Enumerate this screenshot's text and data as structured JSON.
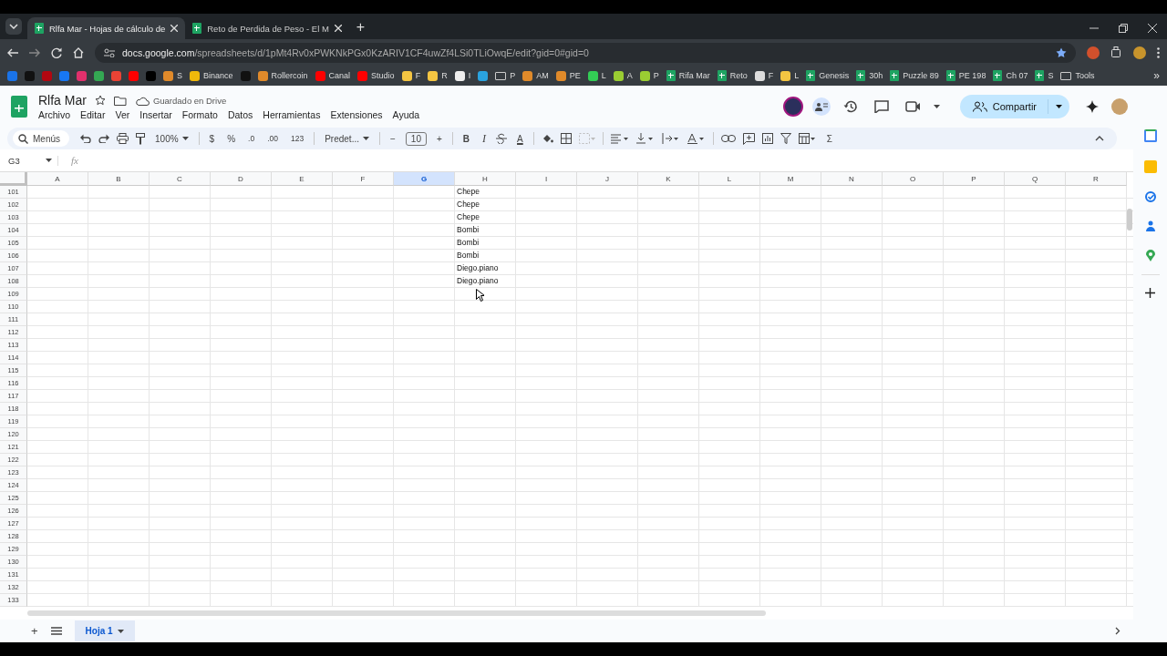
{
  "browser": {
    "tabs": [
      {
        "title": "Rlfa Mar - Hojas de cálculo de ",
        "selected": true
      },
      {
        "title": "Reto de Perdida de Peso - El M",
        "selected": false
      }
    ],
    "new_tab": "+",
    "url_host": "docs.google.com",
    "url_path": "/spreadsheets/d/1pMt4Rv0xPWKNkPGx0KzARIV1CF4uwZf4LSi0TLiOwqE/edit?gid=0#gid=0",
    "bookmarks": [
      {
        "kind": "site",
        "color": "#1a73e8"
      },
      {
        "kind": "site",
        "color": "#111111"
      },
      {
        "kind": "site",
        "color": "#b20710"
      },
      {
        "kind": "site",
        "color": "#1877f2"
      },
      {
        "kind": "site",
        "color": "#e1306c"
      },
      {
        "kind": "site",
        "color": "#34a853"
      },
      {
        "kind": "site",
        "color": "#ea4335"
      },
      {
        "kind": "site",
        "color": "#ff0000"
      },
      {
        "kind": "site",
        "color": "#000000"
      },
      {
        "kind": "site",
        "color": "#e08a2a",
        "label": "S"
      },
      {
        "kind": "site",
        "color": "#f0b90b",
        "label": "Binance"
      },
      {
        "kind": "site",
        "color": "#111111"
      },
      {
        "kind": "site",
        "color": "#e08a2a",
        "label": "Rollercoin"
      },
      {
        "kind": "site",
        "color": "#ff0000",
        "label": "Canal"
      },
      {
        "kind": "site",
        "color": "#ff0000",
        "label": "Studio"
      },
      {
        "kind": "site",
        "color": "#f4c542",
        "label": "F"
      },
      {
        "kind": "site",
        "color": "#f4c542",
        "label": "R"
      },
      {
        "kind": "site",
        "color": "#eeeeee",
        "label": "I"
      },
      {
        "kind": "site",
        "color": "#2aa3df"
      },
      {
        "kind": "folder",
        "label": "P"
      },
      {
        "kind": "site",
        "color": "#e08a2a",
        "label": "AM"
      },
      {
        "kind": "site",
        "color": "#e08a2a",
        "label": "PE"
      },
      {
        "kind": "site",
        "color": "#33cc55",
        "label": "L"
      },
      {
        "kind": "site",
        "color": "#9acd32",
        "label": "A"
      },
      {
        "kind": "site",
        "color": "#9acd32",
        "label": "P"
      },
      {
        "kind": "sheets",
        "label": "Rifa Mar"
      },
      {
        "kind": "sheets",
        "label": "Reto"
      },
      {
        "kind": "site",
        "color": "#dddddd",
        "label": "F"
      },
      {
        "kind": "site",
        "color": "#f4c542",
        "label": "L"
      },
      {
        "kind": "sheets",
        "label": "Genesis"
      },
      {
        "kind": "sheets",
        "label": "30h"
      },
      {
        "kind": "sheets",
        "label": "Puzzle 89"
      },
      {
        "kind": "sheets",
        "label": "PE 198"
      },
      {
        "kind": "sheets",
        "label": "Ch 07"
      },
      {
        "kind": "sheets",
        "label": "S"
      },
      {
        "kind": "folder",
        "label": "Tools"
      }
    ],
    "bookmarks_more": "»"
  },
  "doc": {
    "title": "Rlfa Mar",
    "save_status": "Guardado en Drive",
    "menu": [
      "Archivo",
      "Editar",
      "Ver",
      "Insertar",
      "Formato",
      "Datos",
      "Herramientas",
      "Extensiones",
      "Ayuda"
    ],
    "share": "Compartir"
  },
  "toolbar": {
    "search": "Menús",
    "zoom": "100%",
    "currency": "$",
    "percent": "%",
    "decimals_less": ".0",
    "decimals_more": ".00",
    "number_format": "123",
    "font": "Predet...",
    "size_minus": "−",
    "font_size": "10",
    "size_plus": "+",
    "bold": "B",
    "italic": "I",
    "text_color": "A",
    "functions": "Σ"
  },
  "formula_bar": {
    "cell_ref": "G3",
    "fx": "fx"
  },
  "grid": {
    "columns": [
      {
        "label": "A",
        "selected": false
      },
      {
        "label": "B",
        "selected": false
      },
      {
        "label": "C",
        "selected": false
      },
      {
        "label": "D",
        "selected": false
      },
      {
        "label": "E",
        "selected": false
      },
      {
        "label": "F",
        "selected": false
      },
      {
        "label": "G",
        "selected": true
      },
      {
        "label": "H",
        "selected": false
      },
      {
        "label": "I",
        "selected": false
      },
      {
        "label": "J",
        "selected": false
      },
      {
        "label": "K",
        "selected": false
      },
      {
        "label": "L",
        "selected": false
      },
      {
        "label": "M",
        "selected": false
      },
      {
        "label": "N",
        "selected": false
      },
      {
        "label": "O",
        "selected": false
      },
      {
        "label": "P",
        "selected": false
      },
      {
        "label": "Q",
        "selected": false
      },
      {
        "label": "R",
        "selected": false
      }
    ],
    "rows": [
      {
        "number": "101",
        "cells": {
          "H": "Chepe"
        }
      },
      {
        "number": "102",
        "cells": {
          "H": "Chepe"
        }
      },
      {
        "number": "103",
        "cells": {
          "H": "Chepe"
        }
      },
      {
        "number": "104",
        "cells": {
          "H": "Bombi"
        }
      },
      {
        "number": "105",
        "cells": {
          "H": "Bombi"
        }
      },
      {
        "number": "106",
        "cells": {
          "H": "Bombi"
        }
      },
      {
        "number": "107",
        "cells": {
          "H": "Diego.piano"
        }
      },
      {
        "number": "108",
        "cells": {
          "H": "Diego.piano"
        }
      },
      {
        "number": "109"
      },
      {
        "number": "110"
      },
      {
        "number": "111"
      },
      {
        "number": "112"
      },
      {
        "number": "113"
      },
      {
        "number": "114"
      },
      {
        "number": "115"
      },
      {
        "number": "116"
      },
      {
        "number": "117"
      },
      {
        "number": "118"
      },
      {
        "number": "119"
      },
      {
        "number": "120"
      },
      {
        "number": "121"
      },
      {
        "number": "122"
      },
      {
        "number": "123"
      },
      {
        "number": "124"
      },
      {
        "number": "125"
      },
      {
        "number": "126"
      },
      {
        "number": "127"
      },
      {
        "number": "128"
      },
      {
        "number": "129"
      },
      {
        "number": "130"
      },
      {
        "number": "131"
      },
      {
        "number": "132"
      },
      {
        "number": "133"
      }
    ]
  },
  "sheets": {
    "add": "+",
    "tabs": [
      {
        "label": "Hoja 1",
        "selected": true
      }
    ]
  }
}
